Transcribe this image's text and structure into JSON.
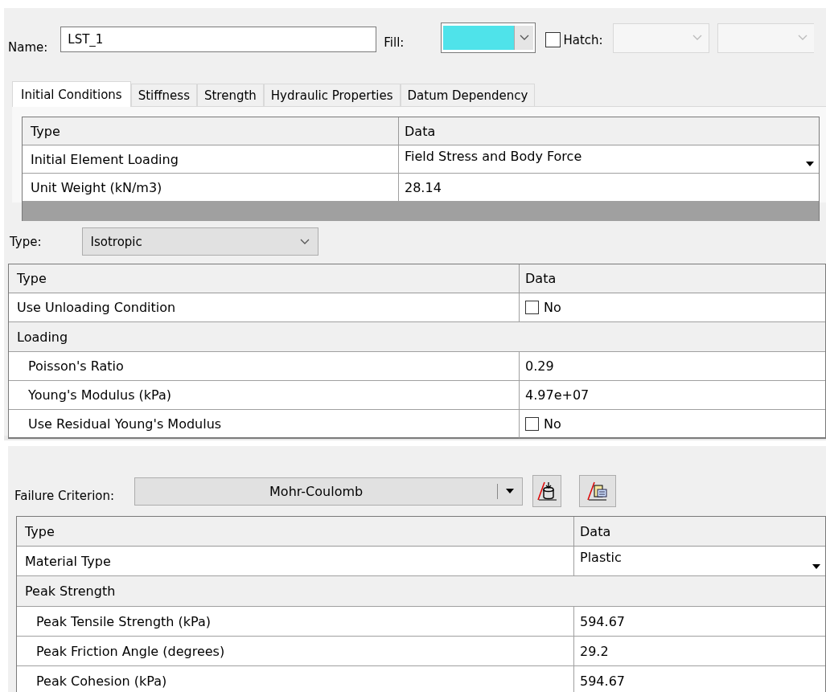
{
  "name_field": {
    "label": "Name:",
    "value": "LST_1"
  },
  "fill": {
    "label": "Fill:",
    "color": "#4fe3ea"
  },
  "hatch": {
    "label": "Hatch:",
    "checked": false
  },
  "tabs": [
    {
      "label": "Initial Conditions",
      "selected": true
    },
    {
      "label": "Stiffness",
      "selected": false
    },
    {
      "label": "Strength",
      "selected": false
    },
    {
      "label": "Hydraulic Properties",
      "selected": false
    },
    {
      "label": "Datum Dependency",
      "selected": false
    }
  ],
  "initial_conditions_table": {
    "columns": [
      "Type",
      "Data"
    ],
    "rows": [
      {
        "kind": "dropdown",
        "type": "Initial Element Loading",
        "data": "Field Stress and Body Force"
      },
      {
        "kind": "value",
        "type": "Unit Weight (kN/m3)",
        "data": "28.14"
      }
    ]
  },
  "stiffness": {
    "type_label": "Type:",
    "type_value": "Isotropic",
    "table": {
      "columns": [
        "Type",
        "Data"
      ],
      "rows": [
        {
          "kind": "checkbox",
          "type": "Use Unloading Condition",
          "checked": false,
          "data": "No"
        },
        {
          "kind": "group",
          "type": "Loading",
          "children": [
            {
              "kind": "value",
              "type": "Poisson's Ratio",
              "data": "0.29"
            },
            {
              "kind": "value",
              "type": "Young's Modulus (kPa)",
              "data": "4.97e+07"
            },
            {
              "kind": "checkbox",
              "type": "Use Residual Young's Modulus",
              "checked": false,
              "data": "No"
            }
          ]
        }
      ]
    }
  },
  "strength": {
    "failure_label": "Failure Criterion:",
    "failure_value": "Mohr-Coulomb",
    "table": {
      "columns": [
        "Type",
        "Data"
      ],
      "rows": [
        {
          "kind": "dropdown",
          "type": "Material Type",
          "data": "Plastic"
        },
        {
          "kind": "group",
          "type": "Peak Strength",
          "children": [
            {
              "kind": "value",
              "type": "Peak Tensile Strength (kPa)",
              "data": "594.67"
            },
            {
              "kind": "value",
              "type": "Peak Friction Angle (degrees)",
              "data": "29.2"
            },
            {
              "kind": "value",
              "type": "Peak Cohesion (kPa)",
              "data": "594.67"
            }
          ]
        }
      ]
    }
  }
}
